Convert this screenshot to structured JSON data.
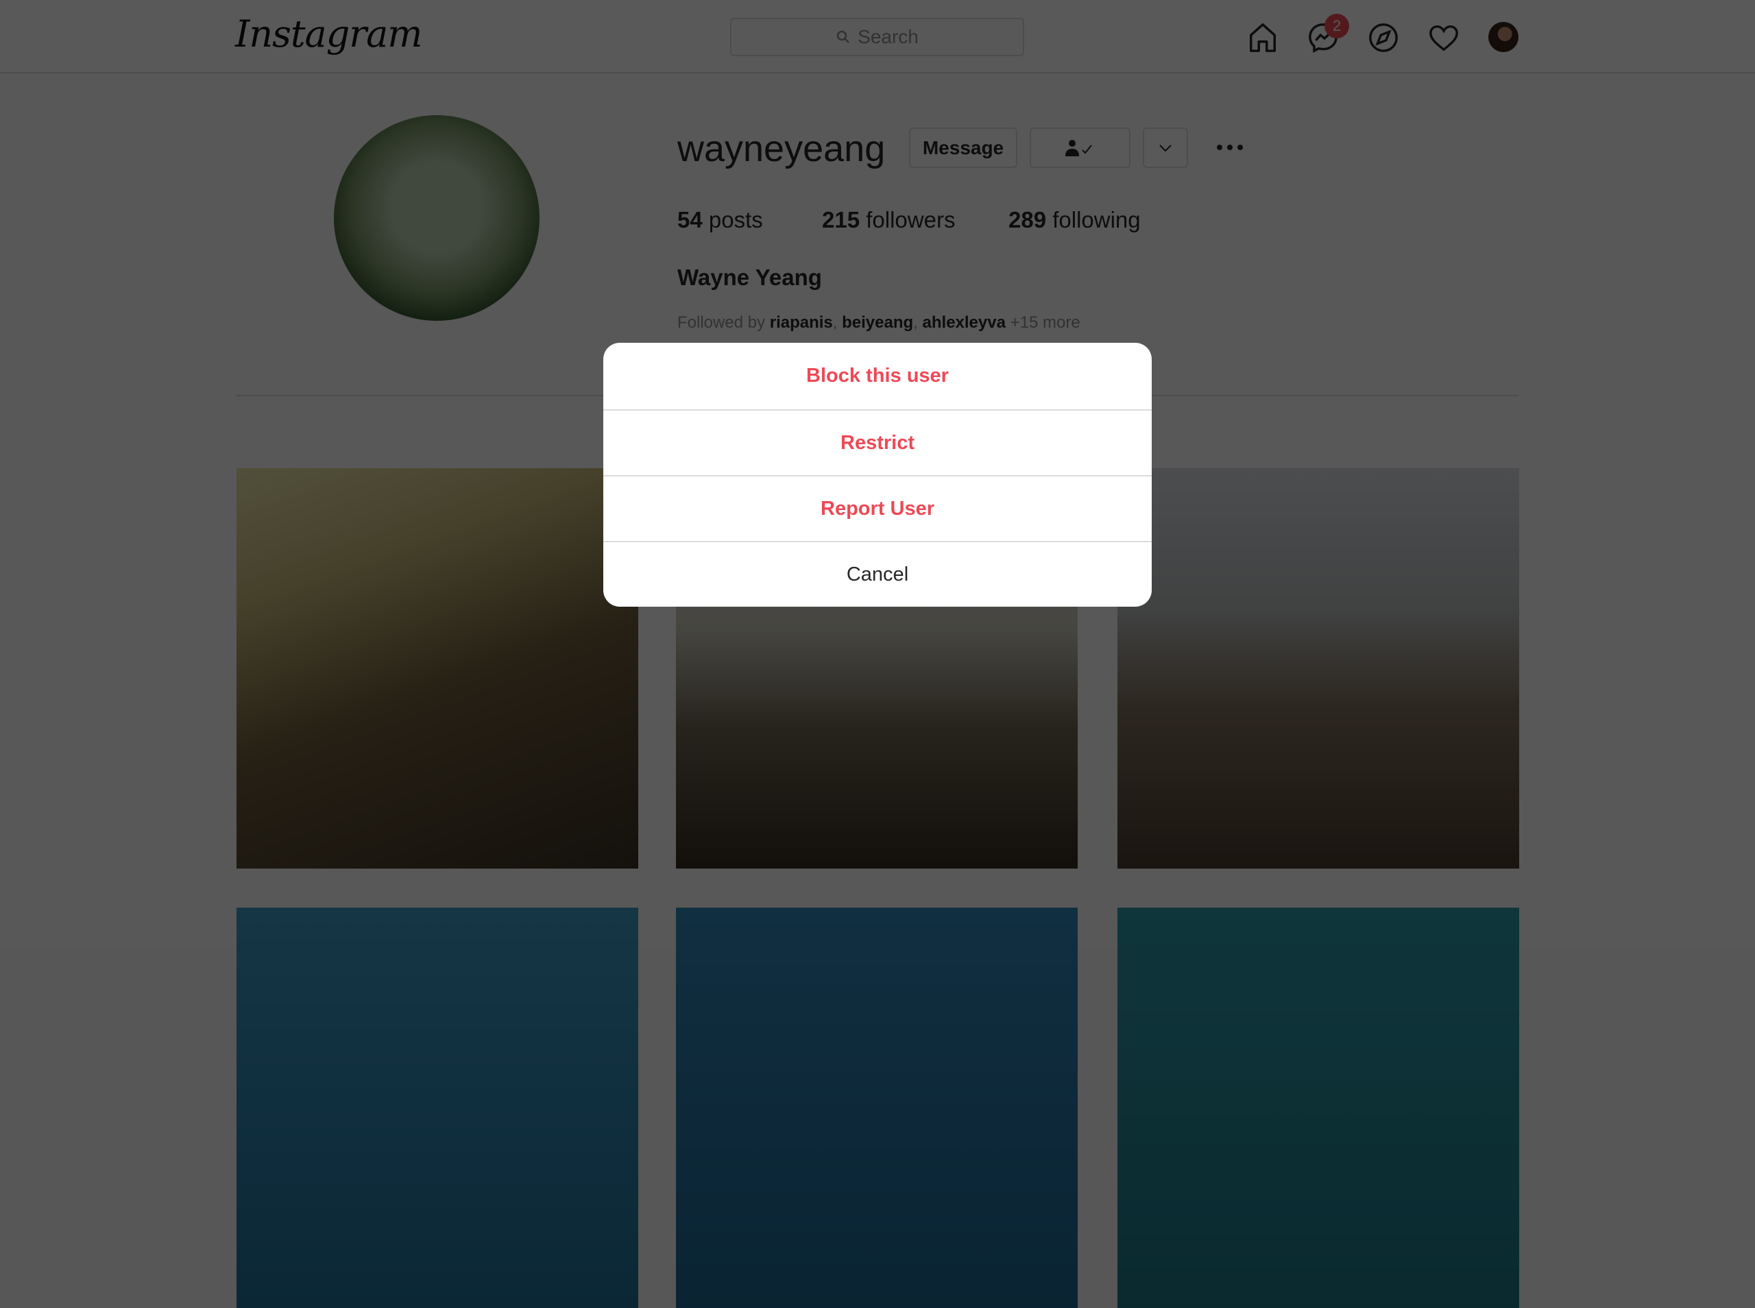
{
  "header": {
    "logo": "Instagram",
    "search_placeholder": "Search",
    "messages_badge": "2",
    "icons": [
      "home-icon",
      "messenger-icon",
      "explore-icon",
      "heart-icon",
      "profile-avatar"
    ]
  },
  "profile": {
    "username": "wayneyeang",
    "message_label": "Message",
    "posts_count": "54",
    "posts_label": "posts",
    "followers_count": "215",
    "followers_label": "followers",
    "following_count": "289",
    "following_label": "following",
    "full_name": "Wayne Yeang",
    "followed_by_prefix": "Followed by",
    "followed_by": [
      "riapanis",
      "beiyeang",
      "ahlexleyva"
    ],
    "followed_by_more": "+15 more"
  },
  "modal": {
    "items": [
      {
        "label": "Block this user",
        "danger": true
      },
      {
        "label": "Restrict",
        "danger": true
      },
      {
        "label": "Report User",
        "danger": true
      },
      {
        "label": "Cancel",
        "danger": false
      }
    ]
  },
  "colors": {
    "danger": "#ed4956",
    "overlay": "rgba(0,0,0,0.65)"
  }
}
